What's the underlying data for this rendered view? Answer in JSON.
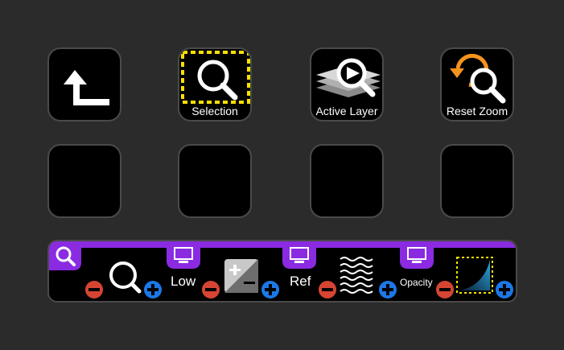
{
  "keys": [
    {
      "label": "",
      "icon": "back-arrow-icon"
    },
    {
      "label": "Selection",
      "icon": "zoom-selection-icon"
    },
    {
      "label": "Active Layer",
      "icon": "zoom-active-layer-icon"
    },
    {
      "label": "Reset Zoom",
      "icon": "reset-zoom-icon"
    }
  ],
  "dials": [
    {
      "label": "",
      "icon": "zoom-icon"
    },
    {
      "label": "Low",
      "icon": "exposure-icon"
    },
    {
      "label": "Ref",
      "icon": "wave-reference-icon"
    },
    {
      "label": "Opacity",
      "icon": "opacity-gradient-icon"
    }
  ],
  "colors": {
    "background": "#2b2b2b",
    "key": "#000000",
    "accent": "#8a2be2",
    "selection_dash": "#ffe000",
    "minus": "#d64533",
    "plus": "#1b78e6",
    "reset_orange": "#f5931e"
  }
}
